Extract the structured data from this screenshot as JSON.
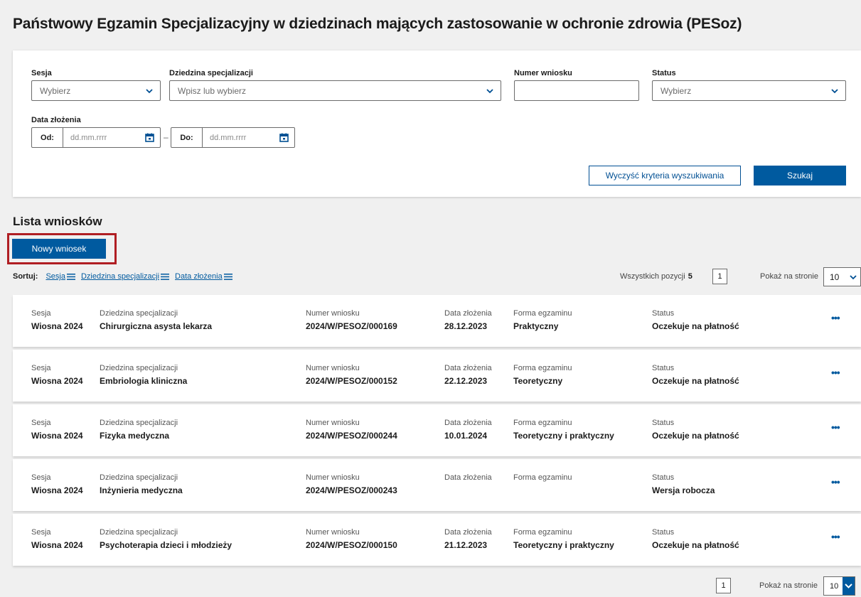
{
  "page_title": "Państwowy Egzamin Specjalizacyjny w dziedzinach mających zastosowanie w ochronie zdrowia (PESoz)",
  "filters": {
    "session_label": "Sesja",
    "session_placeholder": "Wybierz",
    "field_label": "Dziedzina specjalizacji",
    "field_placeholder": "Wpisz lub wybierz",
    "number_label": "Numer wniosku",
    "number_value": "",
    "status_label": "Status",
    "status_placeholder": "Wybierz",
    "date_label": "Data złożenia",
    "from_label": "Od:",
    "to_label": "Do:",
    "date_placeholder": "dd.mm.rrrr",
    "date_separator": "–",
    "clear_button": "Wyczyść kryteria wyszukiwania",
    "search_button": "Szukaj"
  },
  "list": {
    "title": "Lista wniosków",
    "new_button": "Nowy wniosek",
    "sort_label": "Sortuj:",
    "sort_options": [
      "Sesja",
      "Dziedzina specjalizacji",
      "Data złożenia"
    ],
    "total_label": "Wszystkich pozycji",
    "total_count": "5",
    "page": "1",
    "per_page_label": "Pokaż na stronie",
    "per_page_value": "10"
  },
  "columns": {
    "session": "Sesja",
    "field": "Dziedzina specjalizacji",
    "number": "Numer wniosku",
    "date": "Data złożenia",
    "form": "Forma egzaminu",
    "status": "Status"
  },
  "rows": [
    {
      "session": "Wiosna 2024",
      "field": "Chirurgiczna asysta lekarza",
      "number": "2024/W/PESOZ/000169",
      "date": "28.12.2023",
      "form": "Praktyczny",
      "status": "Oczekuje na płatność"
    },
    {
      "session": "Wiosna 2024",
      "field": "Embriologia kliniczna",
      "number": "2024/W/PESOZ/000152",
      "date": "22.12.2023",
      "form": "Teoretyczny",
      "status": "Oczekuje na płatność"
    },
    {
      "session": "Wiosna 2024",
      "field": "Fizyka medyczna",
      "number": "2024/W/PESOZ/000244",
      "date": "10.01.2024",
      "form": "Teoretyczny i praktyczny",
      "status": "Oczekuje na płatność"
    },
    {
      "session": "Wiosna 2024",
      "field": "Inżynieria medyczna",
      "number": "2024/W/PESOZ/000243",
      "date": "",
      "form": "",
      "status": "Wersja robocza"
    },
    {
      "session": "Wiosna 2024",
      "field": "Psychoterapia dzieci i młodzieży",
      "number": "2024/W/PESOZ/000150",
      "date": "21.12.2023",
      "form": "Teoretyczny i praktyczny",
      "status": "Oczekuje na płatność"
    }
  ],
  "row_menu_symbol": "•••",
  "colors": {
    "primary": "#005a9f",
    "highlight": "#b01e23",
    "background": "#f0f0f0"
  }
}
